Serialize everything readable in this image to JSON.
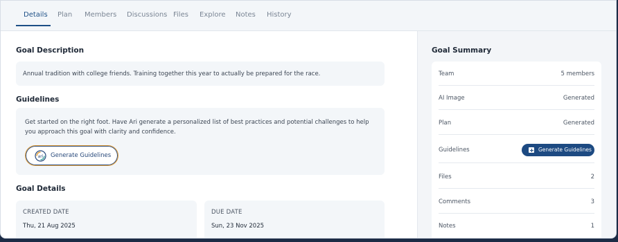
{
  "tabs": [
    {
      "label": "Details",
      "active": true
    },
    {
      "label": "Plan"
    },
    {
      "label": "Members"
    },
    {
      "label": "Discussions"
    },
    {
      "label": "Files"
    },
    {
      "label": "Explore"
    },
    {
      "label": "Notes"
    },
    {
      "label": "History"
    }
  ],
  "goal_description": {
    "title": "Goal Description",
    "text": "Annual tradition with college friends. Training together this year to actually be prepared for the race."
  },
  "guidelines": {
    "title": "Guidelines",
    "text": "Get started on the right foot. Have Ari generate a personalized list of best practices and potential challenges to help you approach this goal with clarity and confidence.",
    "button_label": "Generate Guidelines",
    "icon_text": "ari"
  },
  "goal_details": {
    "title": "Goal Details",
    "created_label": "CREATED DATE",
    "created_value": "Thu, 21 Aug 2025",
    "due_label": "DUE DATE",
    "due_value": "Sun, 23 Nov 2025"
  },
  "summary": {
    "title": "Goal Summary",
    "rows": [
      {
        "key": "Team",
        "value": "5 members"
      },
      {
        "key": "AI Image",
        "value": "Generated"
      },
      {
        "key": "Plan",
        "value": "Generated"
      },
      {
        "key": "Guidelines",
        "button": "Generate Guidelines"
      },
      {
        "key": "Files",
        "value": "2"
      },
      {
        "key": "Comments",
        "value": "3"
      },
      {
        "key": "Notes",
        "value": "1"
      }
    ]
  },
  "colors": {
    "accent": "#1c4f86",
    "button_border": "#e5a03a",
    "backdrop": "#1c2b45"
  }
}
